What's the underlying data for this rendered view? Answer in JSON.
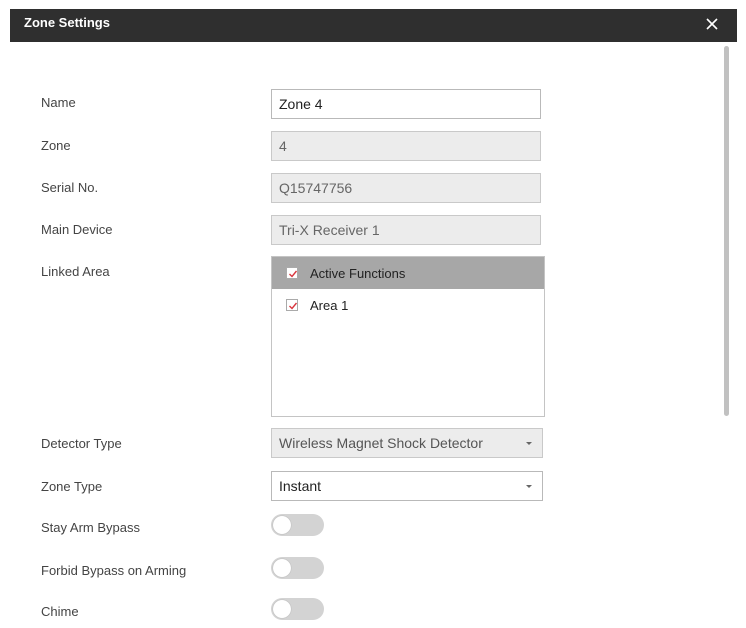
{
  "dialog": {
    "title": "Zone Settings"
  },
  "form": {
    "name": {
      "label": "Name",
      "value": "Zone 4"
    },
    "zone": {
      "label": "Zone",
      "value": "4"
    },
    "serial": {
      "label": "Serial No.",
      "value": "Q15747756"
    },
    "main_device": {
      "label": "Main Device",
      "value": "Tri-X Receiver 1"
    },
    "linked_area": {
      "label": "Linked Area",
      "items": [
        {
          "label": "Active Functions",
          "checked": true
        },
        {
          "label": "Area 1",
          "checked": true
        }
      ]
    },
    "detector_type": {
      "label": "Detector Type",
      "value": "Wireless Magnet Shock Detector"
    },
    "zone_type": {
      "label": "Zone Type",
      "value": "Instant"
    },
    "stay_arm_bypass": {
      "label": "Stay Arm Bypass",
      "on": false
    },
    "forbid_bypass": {
      "label": "Forbid Bypass on Arming",
      "on": false
    },
    "chime": {
      "label": "Chime",
      "on": false
    }
  },
  "colors": {
    "titlebar": "#2f2f2f",
    "check": "#d9363e",
    "list_header": "#a7a7a7",
    "toggle_off": "#d3d3d3"
  }
}
